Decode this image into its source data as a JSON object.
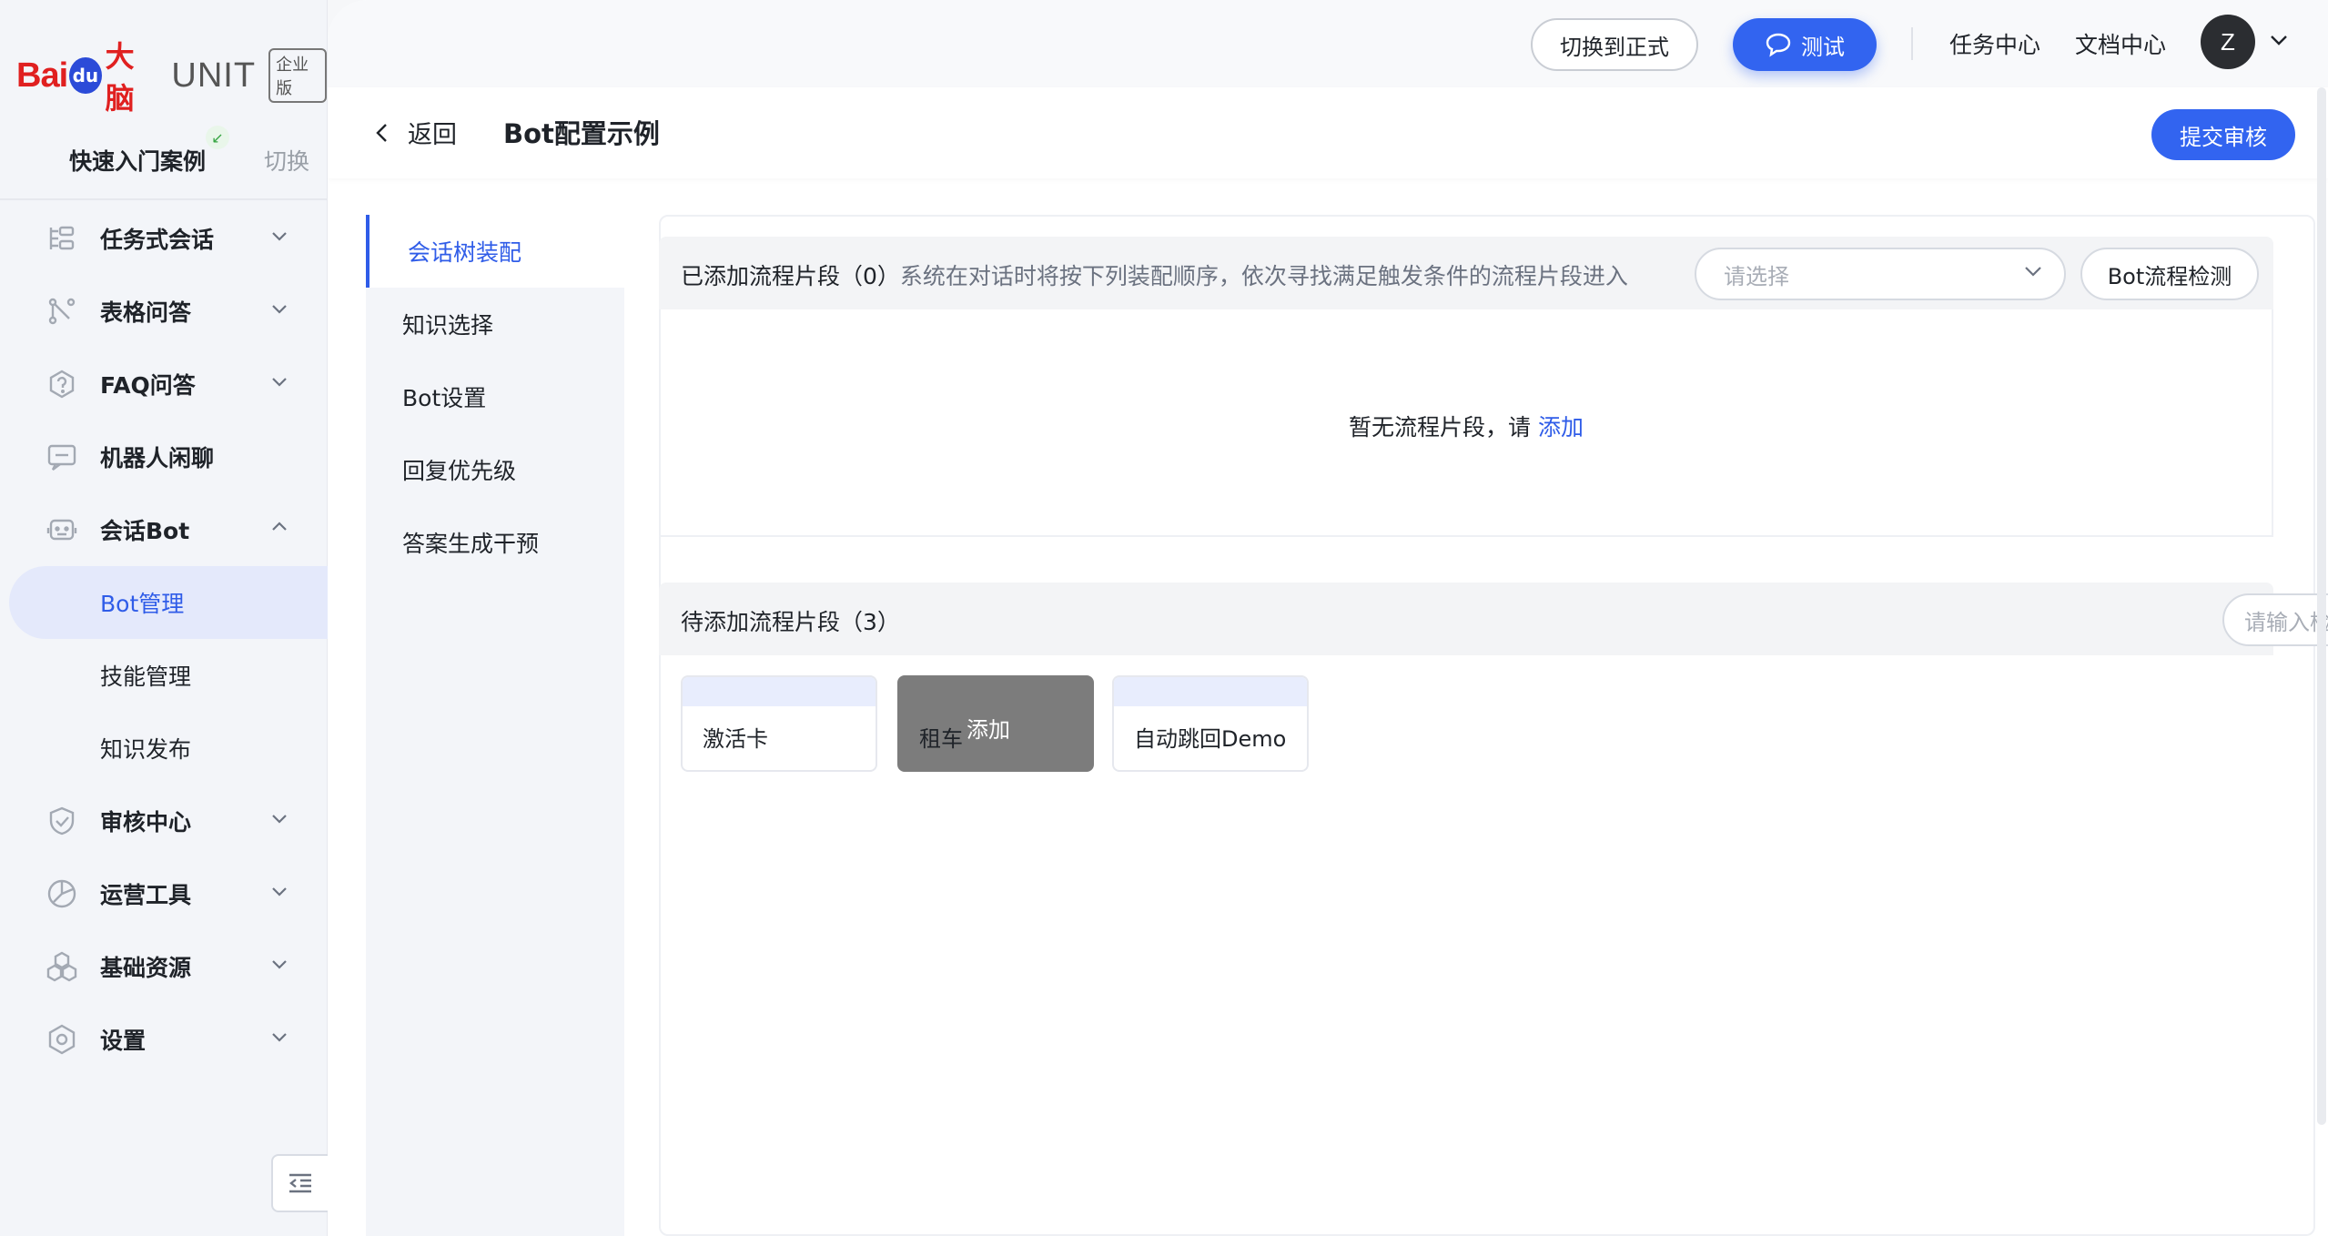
{
  "brand": {
    "logo_bai": "Bai",
    "logo_du": "du",
    "logo_danao": "大脑",
    "logo_unit": "UNIT",
    "logo_tag": "企业版"
  },
  "sidebar": {
    "case_name": "快速入门案例",
    "switch_label": "切换",
    "items": [
      {
        "label": "任务式会话",
        "icon": "task-dialog-icon",
        "expanded": false
      },
      {
        "label": "表格问答",
        "icon": "table-qa-icon",
        "expanded": false
      },
      {
        "label": "FAQ问答",
        "icon": "faq-icon",
        "expanded": false
      },
      {
        "label": "机器人闲聊",
        "icon": "chat-icon"
      },
      {
        "label": "会话Bot",
        "icon": "bot-icon",
        "expanded": true
      },
      {
        "label": "审核中心",
        "icon": "shield-check-icon",
        "expanded": false
      },
      {
        "label": "运营工具",
        "icon": "operation-icon",
        "expanded": false
      },
      {
        "label": "基础资源",
        "icon": "resource-icon",
        "expanded": false
      },
      {
        "label": "设置",
        "icon": "settings-icon",
        "expanded": false
      }
    ],
    "bot_subitems": [
      {
        "label": "Bot管理",
        "active": true
      },
      {
        "label": "技能管理",
        "active": false
      },
      {
        "label": "知识发布",
        "active": false
      }
    ]
  },
  "topbar": {
    "switch_env_label": "切换到正式",
    "test_label": "测试",
    "task_center": "任务中心",
    "doc_center": "文档中心",
    "avatar_initial": "Z"
  },
  "pagehead": {
    "back_label": "返回",
    "title": "Bot配置示例",
    "submit_label": "提交审核"
  },
  "tabs": [
    {
      "label": "会话树装配",
      "active": true
    },
    {
      "label": "知识选择",
      "active": false
    },
    {
      "label": "Bot设置",
      "active": false
    },
    {
      "label": "回复优先级",
      "active": false
    },
    {
      "label": "答案生成干预",
      "active": false
    }
  ],
  "added": {
    "title": "已添加流程片段（0）",
    "subtitle": "系统在对话时将按下列装配顺序，依次寻找满足触发条件的流程片段进入",
    "select_placeholder": "请选择",
    "check_label": "Bot流程检测",
    "empty_text": "暂无流程片段，请",
    "empty_link": "添加"
  },
  "pending": {
    "title": "待添加流程片段（3）",
    "search_placeholder": "请输入检索内容",
    "fragments": [
      {
        "label": "激活卡",
        "hover": false
      },
      {
        "label": "租车",
        "hover": true,
        "overlay": "添加"
      },
      {
        "label": "自动跳回Demo",
        "hover": false
      }
    ]
  },
  "colors": {
    "primary": "#3264f0",
    "active_text": "#2f5ce8",
    "brand_red": "#e02020"
  }
}
